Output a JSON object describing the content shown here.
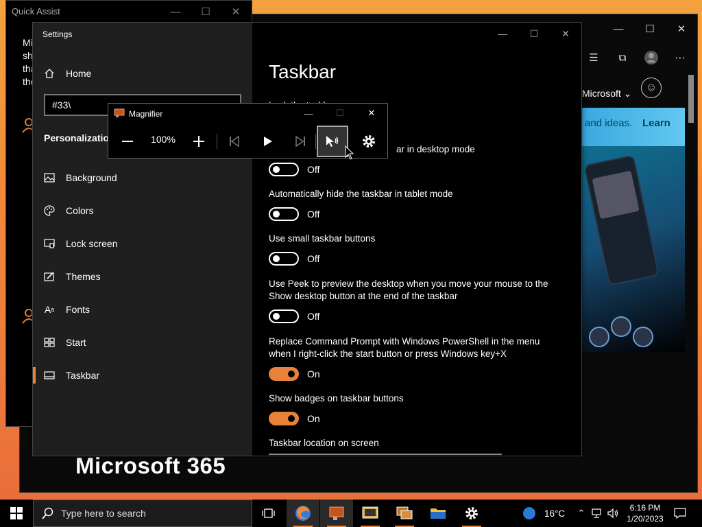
{
  "quick_assist": {
    "title": "Quick Assist",
    "text_lines": [
      "Mi",
      "sh",
      "tha",
      "the"
    ]
  },
  "edge": {
    "account": "Microsoft",
    "banner_text": "and ideas.",
    "banner_link": "Learn",
    "hero_title": "Microsoft 365"
  },
  "settings": {
    "window_title": "Settings",
    "home_label": "Home",
    "search_value": "#33\\",
    "section_title": "Personalization",
    "nav": [
      {
        "label": "Background",
        "icon": "image-icon"
      },
      {
        "label": "Colors",
        "icon": "palette-icon"
      },
      {
        "label": "Lock screen",
        "icon": "lock-screen-icon"
      },
      {
        "label": "Themes",
        "icon": "brush-icon"
      },
      {
        "label": "Fonts",
        "icon": "font-icon"
      },
      {
        "label": "Start",
        "icon": "start-grid-icon"
      },
      {
        "label": "Taskbar",
        "icon": "taskbar-icon",
        "selected": true
      }
    ],
    "page_title": "Taskbar",
    "options": [
      {
        "label": "Lock the taskbar",
        "state": null
      },
      {
        "label": "ar in desktop mode",
        "state": "Off",
        "on": false
      },
      {
        "label": "Automatically hide the taskbar in tablet mode",
        "state": "Off",
        "on": false
      },
      {
        "label": "Use small taskbar buttons",
        "state": "Off",
        "on": false
      },
      {
        "label": "Use Peek to preview the desktop when you move your mouse to the Show desktop button at the end of the taskbar",
        "state": "Off",
        "on": false
      },
      {
        "label": "Replace Command Prompt with Windows PowerShell in the menu when I right-click the start button or press Windows key+X",
        "state": "On",
        "on": true
      },
      {
        "label": "Show badges on taskbar buttons",
        "state": "On",
        "on": true
      },
      {
        "label": "Taskbar location on screen",
        "state": null
      }
    ]
  },
  "magnifier": {
    "title": "Magnifier",
    "zoom": "100%"
  },
  "taskbar": {
    "search_placeholder": "Type here to search",
    "weather": "16°C",
    "time": "6:16 PM",
    "date": "1/20/2023"
  },
  "colors": {
    "accent": "#e8823a",
    "window_bg": "#000000",
    "nav_bg": "#1f1f1f"
  }
}
